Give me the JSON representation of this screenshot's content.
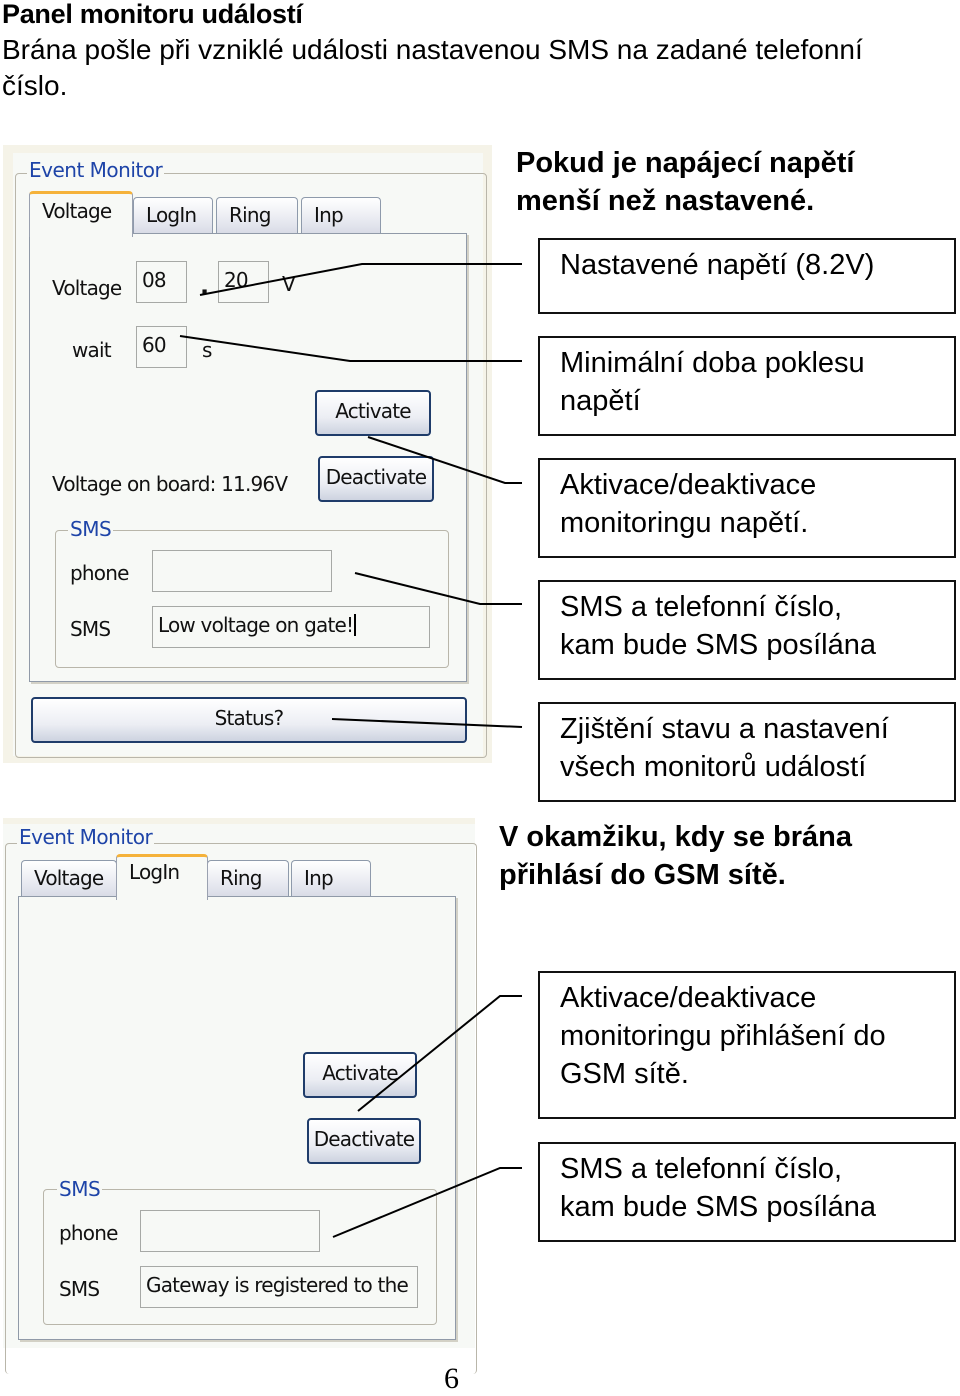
{
  "document": {
    "title": "Panel monitoru událostí",
    "intro": "Brána pošle při vzniklé události nastavenou SMS na zadané telefonní číslo.",
    "page_number": "6"
  },
  "screenshot1": {
    "groupbox_title": "Event Monitor",
    "tabs": [
      {
        "label": "Voltage",
        "active": true
      },
      {
        "label": "LogIn",
        "active": false
      },
      {
        "label": "Ring",
        "active": false
      },
      {
        "label": "Inp",
        "active": false
      }
    ],
    "voltage_label": "Voltage",
    "voltage_int": "08",
    "voltage_sep": ".",
    "voltage_dec": "20",
    "voltage_unit": "V",
    "wait_label": "wait",
    "wait_value": "60",
    "wait_unit": "s",
    "activate_label": "Activate",
    "deactivate_label": "Deactivate",
    "voltage_on_board": "Voltage on board: 11.96V",
    "sms_group_title": "SMS",
    "phone_label": "phone",
    "phone_value": "",
    "sms_label": "SMS",
    "sms_value": "Low voltage on gate!",
    "status_label": "Status?"
  },
  "screenshot2": {
    "groupbox_title": "Event Monitor",
    "tabs": [
      {
        "label": "Voltage",
        "active": false
      },
      {
        "label": "LogIn",
        "active": true
      },
      {
        "label": "Ring",
        "active": false
      },
      {
        "label": "Inp",
        "active": false
      }
    ],
    "activate_label": "Activate",
    "deactivate_label": "Deactivate",
    "sms_group_title": "SMS",
    "phone_label": "phone",
    "phone_value": "",
    "sms_label": "SMS",
    "sms_value": "Gateway is registered to the"
  },
  "annotations1": {
    "heading": [
      "Pokud je napájecí napětí",
      "menší než nastavené."
    ],
    "callouts": [
      {
        "lines": [
          "Nastavené napětí (8.2V)"
        ]
      },
      {
        "lines": [
          "Minimální doba poklesu",
          "napětí"
        ]
      },
      {
        "lines": [
          "Aktivace/deaktivace",
          "monitoringu napětí."
        ]
      },
      {
        "lines": [
          "SMS a telefonní číslo,",
          "kam bude SMS posílána"
        ]
      },
      {
        "lines": [
          "Zjištění stavu a nastavení",
          "všech monitorů událostí"
        ]
      }
    ]
  },
  "annotations2": {
    "heading": [
      "V okamžiku, kdy se brána",
      "přihlásí do GSM sítě."
    ],
    "callouts": [
      {
        "lines": [
          "Aktivace/deaktivace",
          "monitoringu přihlášení do",
          "GSM sítě."
        ]
      },
      {
        "lines": [
          "SMS a telefonní číslo,",
          "kam bude SMS posílána"
        ]
      }
    ]
  }
}
